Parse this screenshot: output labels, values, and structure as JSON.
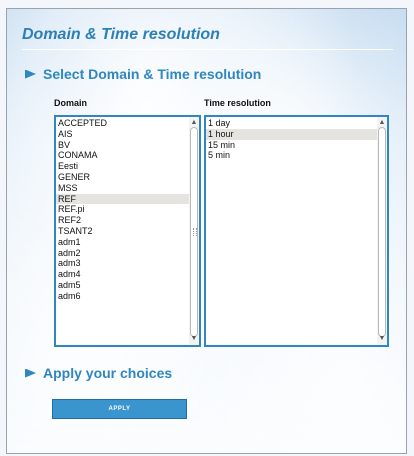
{
  "page": {
    "title": "Domain & Time resolution"
  },
  "sections": {
    "select_heading": "Select Domain & Time resolution",
    "apply_heading": "Apply your choices"
  },
  "domain": {
    "label": "Domain",
    "items": [
      "ACCEPTED",
      "AIS",
      "BV",
      "CONAMA",
      "Eesti",
      "GENER",
      "MSS",
      "REF",
      "REF.pi",
      "REF2",
      "TSANT2",
      "adm1",
      "adm2",
      "adm3",
      "adm4",
      "adm5",
      "adm6"
    ],
    "selected": "REF"
  },
  "time_resolution": {
    "label": "Time resolution",
    "items": [
      "1 day",
      "1 hour",
      "15 min",
      "5 min"
    ],
    "selected": "1 hour"
  },
  "apply_button": {
    "label": "APPLY"
  },
  "colors": {
    "accent": "#2f86c0",
    "button": "#3a95cf",
    "selected_row": "#e6e4e0"
  },
  "icons": {
    "section_bullet": "bullet-arrow-icon",
    "scroll_up": "arrow-up-icon",
    "scroll_down": "arrow-down-icon"
  }
}
